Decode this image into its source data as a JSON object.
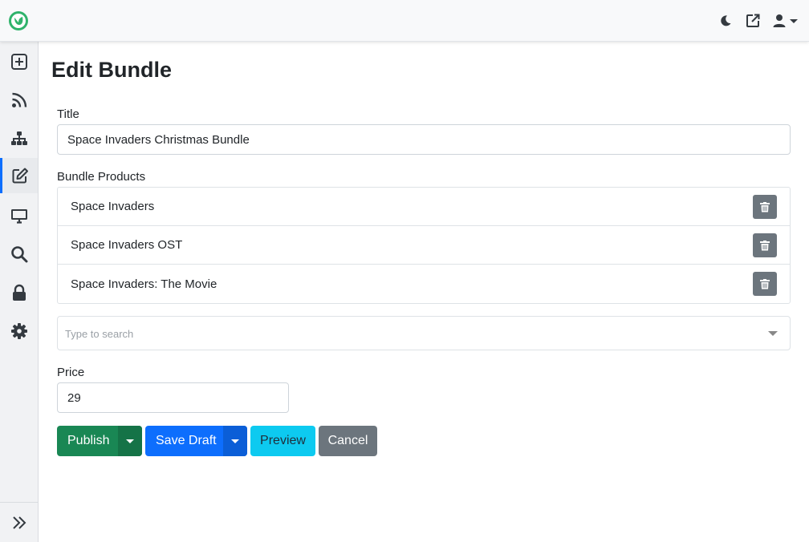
{
  "topbar": {
    "logo_icon": "leaf-logo-icon",
    "icons": [
      "moon-icon",
      "external-link-icon",
      "user-icon"
    ]
  },
  "sidebar": {
    "items": [
      {
        "icon": "plus-square-icon",
        "active": false
      },
      {
        "icon": "rss-icon",
        "active": false
      },
      {
        "icon": "sitemap-icon",
        "active": false
      },
      {
        "icon": "edit-icon",
        "active": true
      },
      {
        "icon": "desktop-icon",
        "active": false
      },
      {
        "icon": "search-icon",
        "active": false
      },
      {
        "icon": "lock-icon",
        "active": false
      },
      {
        "icon": "gear-icon",
        "active": false
      }
    ],
    "collapse_icon": "double-chevron-right-icon"
  },
  "page": {
    "title": "Edit Bundle"
  },
  "form": {
    "title_label": "Title",
    "title_value": "Space Invaders Christmas Bundle",
    "products_label": "Bundle Products",
    "products": [
      {
        "name": "Space Invaders"
      },
      {
        "name": "Space Invaders OST"
      },
      {
        "name": "Space Invaders: The Movie"
      }
    ],
    "search_placeholder": "Type to search",
    "price_label": "Price",
    "price_value": "29"
  },
  "actions": {
    "publish_label": "Publish",
    "save_draft_label": "Save Draft",
    "preview_label": "Preview",
    "cancel_label": "Cancel"
  },
  "colors": {
    "publish": "#198754",
    "save_draft": "#0d6efd",
    "preview": "#0dcaf0",
    "cancel": "#6c757d",
    "active_indicator": "#0d6efd",
    "logo": "#2fb36b"
  }
}
